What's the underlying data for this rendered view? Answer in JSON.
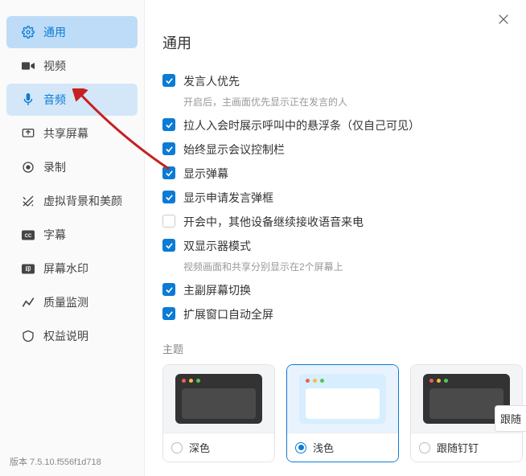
{
  "sidebar": {
    "items": [
      {
        "label": "通用",
        "icon": "gear"
      },
      {
        "label": "视频",
        "icon": "video"
      },
      {
        "label": "音频",
        "icon": "mic"
      },
      {
        "label": "共享屏幕",
        "icon": "share"
      },
      {
        "label": "录制",
        "icon": "record"
      },
      {
        "label": "虚拟背景和美颜",
        "icon": "virtual"
      },
      {
        "label": "字幕",
        "icon": "cc"
      },
      {
        "label": "屏幕水印",
        "icon": "watermark"
      },
      {
        "label": "质量监测",
        "icon": "quality"
      },
      {
        "label": "权益说明",
        "icon": "rights"
      }
    ]
  },
  "version": "版本 7.5.10.f556f1d718",
  "page_title": "通用",
  "settings": [
    {
      "label": "发言人优先",
      "checked": true,
      "desc": "开启后，主画面优先显示正在发言的人"
    },
    {
      "label": "拉人入会时展示呼叫中的悬浮条（仅自己可见）",
      "checked": true
    },
    {
      "label": "始终显示会议控制栏",
      "checked": true
    },
    {
      "label": "显示弹幕",
      "checked": true
    },
    {
      "label": "显示申请发言弹框",
      "checked": true
    },
    {
      "label": "开会中，其他设备继续接收语音来电",
      "checked": false
    },
    {
      "label": "双显示器模式",
      "checked": true,
      "desc": "视频画面和共享分别显示在2个屏幕上"
    },
    {
      "label": "主副屏幕切换",
      "checked": true
    },
    {
      "label": "扩展窗口自动全屏",
      "checked": true
    }
  ],
  "theme_section_label": "主题",
  "themes": [
    {
      "name": "深色",
      "selected": false,
      "variant": "dark"
    },
    {
      "name": "浅色",
      "selected": true,
      "variant": "light"
    },
    {
      "name": "跟随钉钉",
      "selected": false,
      "variant": "follow"
    }
  ],
  "follow_btn": "跟随"
}
